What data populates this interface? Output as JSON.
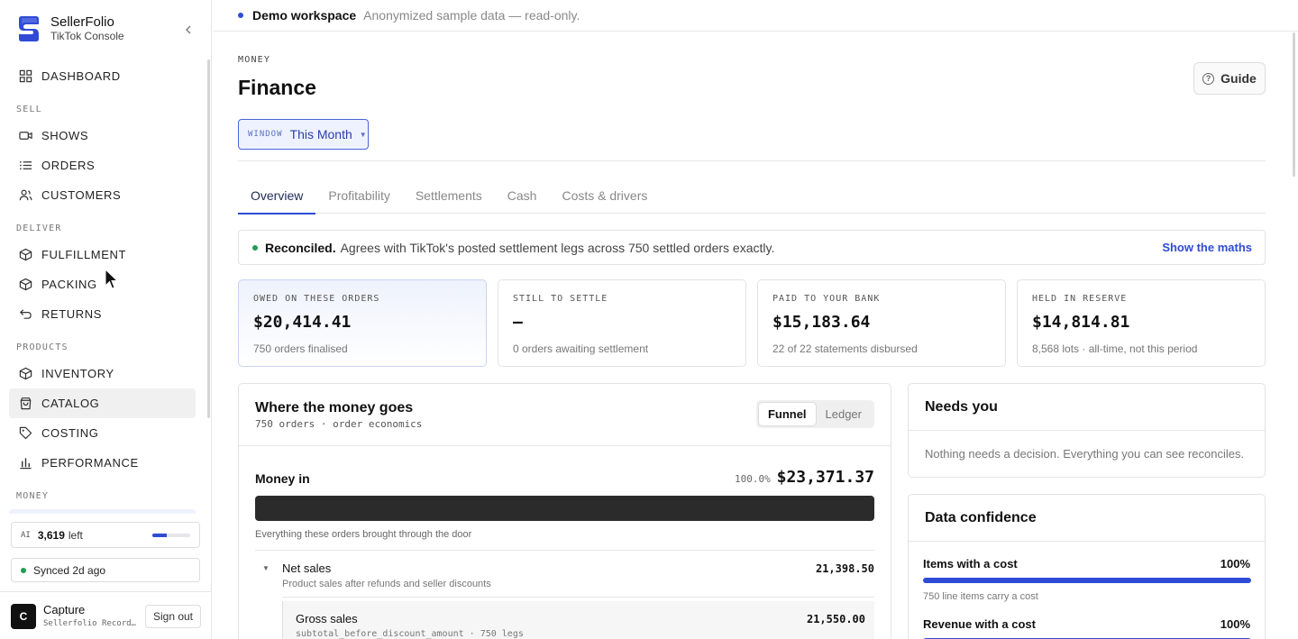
{
  "brand": {
    "name": "SellerFolio",
    "subtitle": "TikTok Console"
  },
  "sidebar": {
    "items": [
      {
        "type": "item",
        "label": "DASHBOARD",
        "icon": "grid-icon"
      },
      {
        "type": "section",
        "label": "SELL"
      },
      {
        "type": "item",
        "label": "SHOWS",
        "icon": "video-icon"
      },
      {
        "type": "item",
        "label": "ORDERS",
        "icon": "list-icon"
      },
      {
        "type": "item",
        "label": "CUSTOMERS",
        "icon": "users-icon"
      },
      {
        "type": "section",
        "label": "DELIVER"
      },
      {
        "type": "item",
        "label": "FULFILLMENT",
        "icon": "box-icon"
      },
      {
        "type": "item",
        "label": "PACKING",
        "icon": "box-icon"
      },
      {
        "type": "item",
        "label": "RETURNS",
        "icon": "return-icon"
      },
      {
        "type": "section",
        "label": "PRODUCTS"
      },
      {
        "type": "item",
        "label": "INVENTORY",
        "icon": "box-icon"
      },
      {
        "type": "item",
        "label": "CATALOG",
        "icon": "bag-icon",
        "active": true
      },
      {
        "type": "item",
        "label": "COSTING",
        "icon": "tag-icon"
      },
      {
        "type": "item",
        "label": "PERFORMANCE",
        "icon": "bar-chart-icon"
      },
      {
        "type": "section",
        "label": "MONEY"
      }
    ],
    "ai": {
      "tag": "AI",
      "count": "3,619",
      "suffix": "left",
      "usage_fraction": 0.38
    },
    "sync": "Synced 2d ago",
    "user": {
      "initial": "C",
      "name": "Capture",
      "email": "Sellerfolio Recorder",
      "signout": "Sign out"
    }
  },
  "banner": {
    "title": "Demo workspace",
    "subtitle": "Anonymized sample data — read-only."
  },
  "page": {
    "eyebrow": "MONEY",
    "title": "Finance",
    "guide": "Guide",
    "window_tag": "WINDOW",
    "window_value": "This Month",
    "tabs": [
      "Overview",
      "Profitability",
      "Settlements",
      "Cash",
      "Costs & drivers"
    ],
    "active_tab": 0
  },
  "reconciled": {
    "strong": "Reconciled.",
    "text": "Agrees with TikTok's posted settlement legs across 750 settled orders exactly.",
    "link": "Show the maths"
  },
  "kpis": [
    {
      "label": "OWED ON THESE ORDERS",
      "value": "$20,414.41",
      "note": "750 orders finalised"
    },
    {
      "label": "STILL TO SETTLE",
      "value": "—",
      "note": "0 orders awaiting settlement"
    },
    {
      "label": "PAID TO YOUR BANK",
      "value": "$15,183.64",
      "note": "22 of 22 statements disbursed"
    },
    {
      "label": "HELD IN RESERVE",
      "value": "$14,814.81",
      "note": "8,568 lots · all-time, not this period"
    }
  ],
  "money": {
    "title": "Where the money goes",
    "subtitle": "750 orders · order economics",
    "toggle": [
      "Funnel",
      "Ledger"
    ],
    "money_in": {
      "label": "Money in",
      "pct": "100.0%",
      "amount": "$23,371.37",
      "desc": "Everything these orders brought through the door"
    },
    "net_sales": {
      "label": "Net sales",
      "desc": "Product sales after refunds and seller discounts",
      "amount": "21,398.50"
    },
    "gross_sales": {
      "label": "Gross sales",
      "desc": "subtotal_before_discount_amount · 750 legs",
      "amount": "21,550.00"
    }
  },
  "needs": {
    "title": "Needs you",
    "text": "Nothing needs a decision. Everything you can see reconciles."
  },
  "confidence": {
    "title": "Data confidence",
    "rows": [
      {
        "label": "Items with a cost",
        "pct": "100%",
        "value": 1.0,
        "note": "750 line items carry a cost"
      },
      {
        "label": "Revenue with a cost",
        "pct": "100%",
        "value": 1.0,
        "note": ""
      }
    ]
  },
  "colors": {
    "accent": "#2f4bd6",
    "success": "#1f9d55",
    "dark_bar": "#2b2b2b"
  }
}
